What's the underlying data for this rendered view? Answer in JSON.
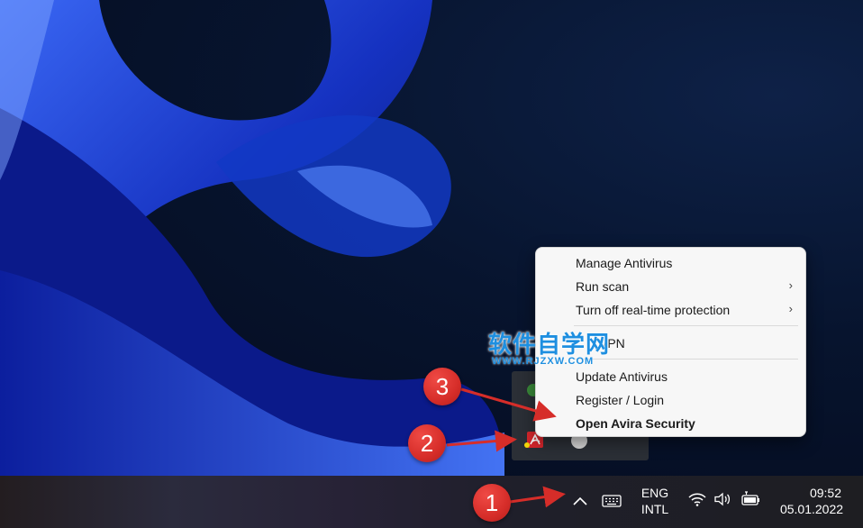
{
  "context_menu": {
    "items": [
      {
        "label": "Manage Antivirus"
      },
      {
        "label": "Run scan",
        "submenu": true
      },
      {
        "label": "Turn off real-time protection",
        "submenu": true
      },
      {
        "label": "VPN"
      },
      {
        "label": "Update Antivirus"
      },
      {
        "label": "Register / Login"
      },
      {
        "label": "Open Avira Security",
        "bold": true
      }
    ]
  },
  "watermark": {
    "cn": "软件自学网",
    "url": "WWW.RJZXW.COM"
  },
  "taskbar": {
    "lang_line1": "ENG",
    "lang_line2": "INTL",
    "time": "09:52",
    "date": "05.01.2022"
  },
  "annotations": {
    "step1": "1",
    "step2": "2",
    "step3": "3"
  },
  "colors": {
    "avira_red": "#d7262c",
    "callout_red": "#d62d29",
    "watermark_blue": "#1e8fe0"
  },
  "icons": [
    "chevron-up-icon",
    "keyboard-icon",
    "wifi-icon",
    "volume-icon",
    "battery-icon",
    "avira-icon"
  ]
}
